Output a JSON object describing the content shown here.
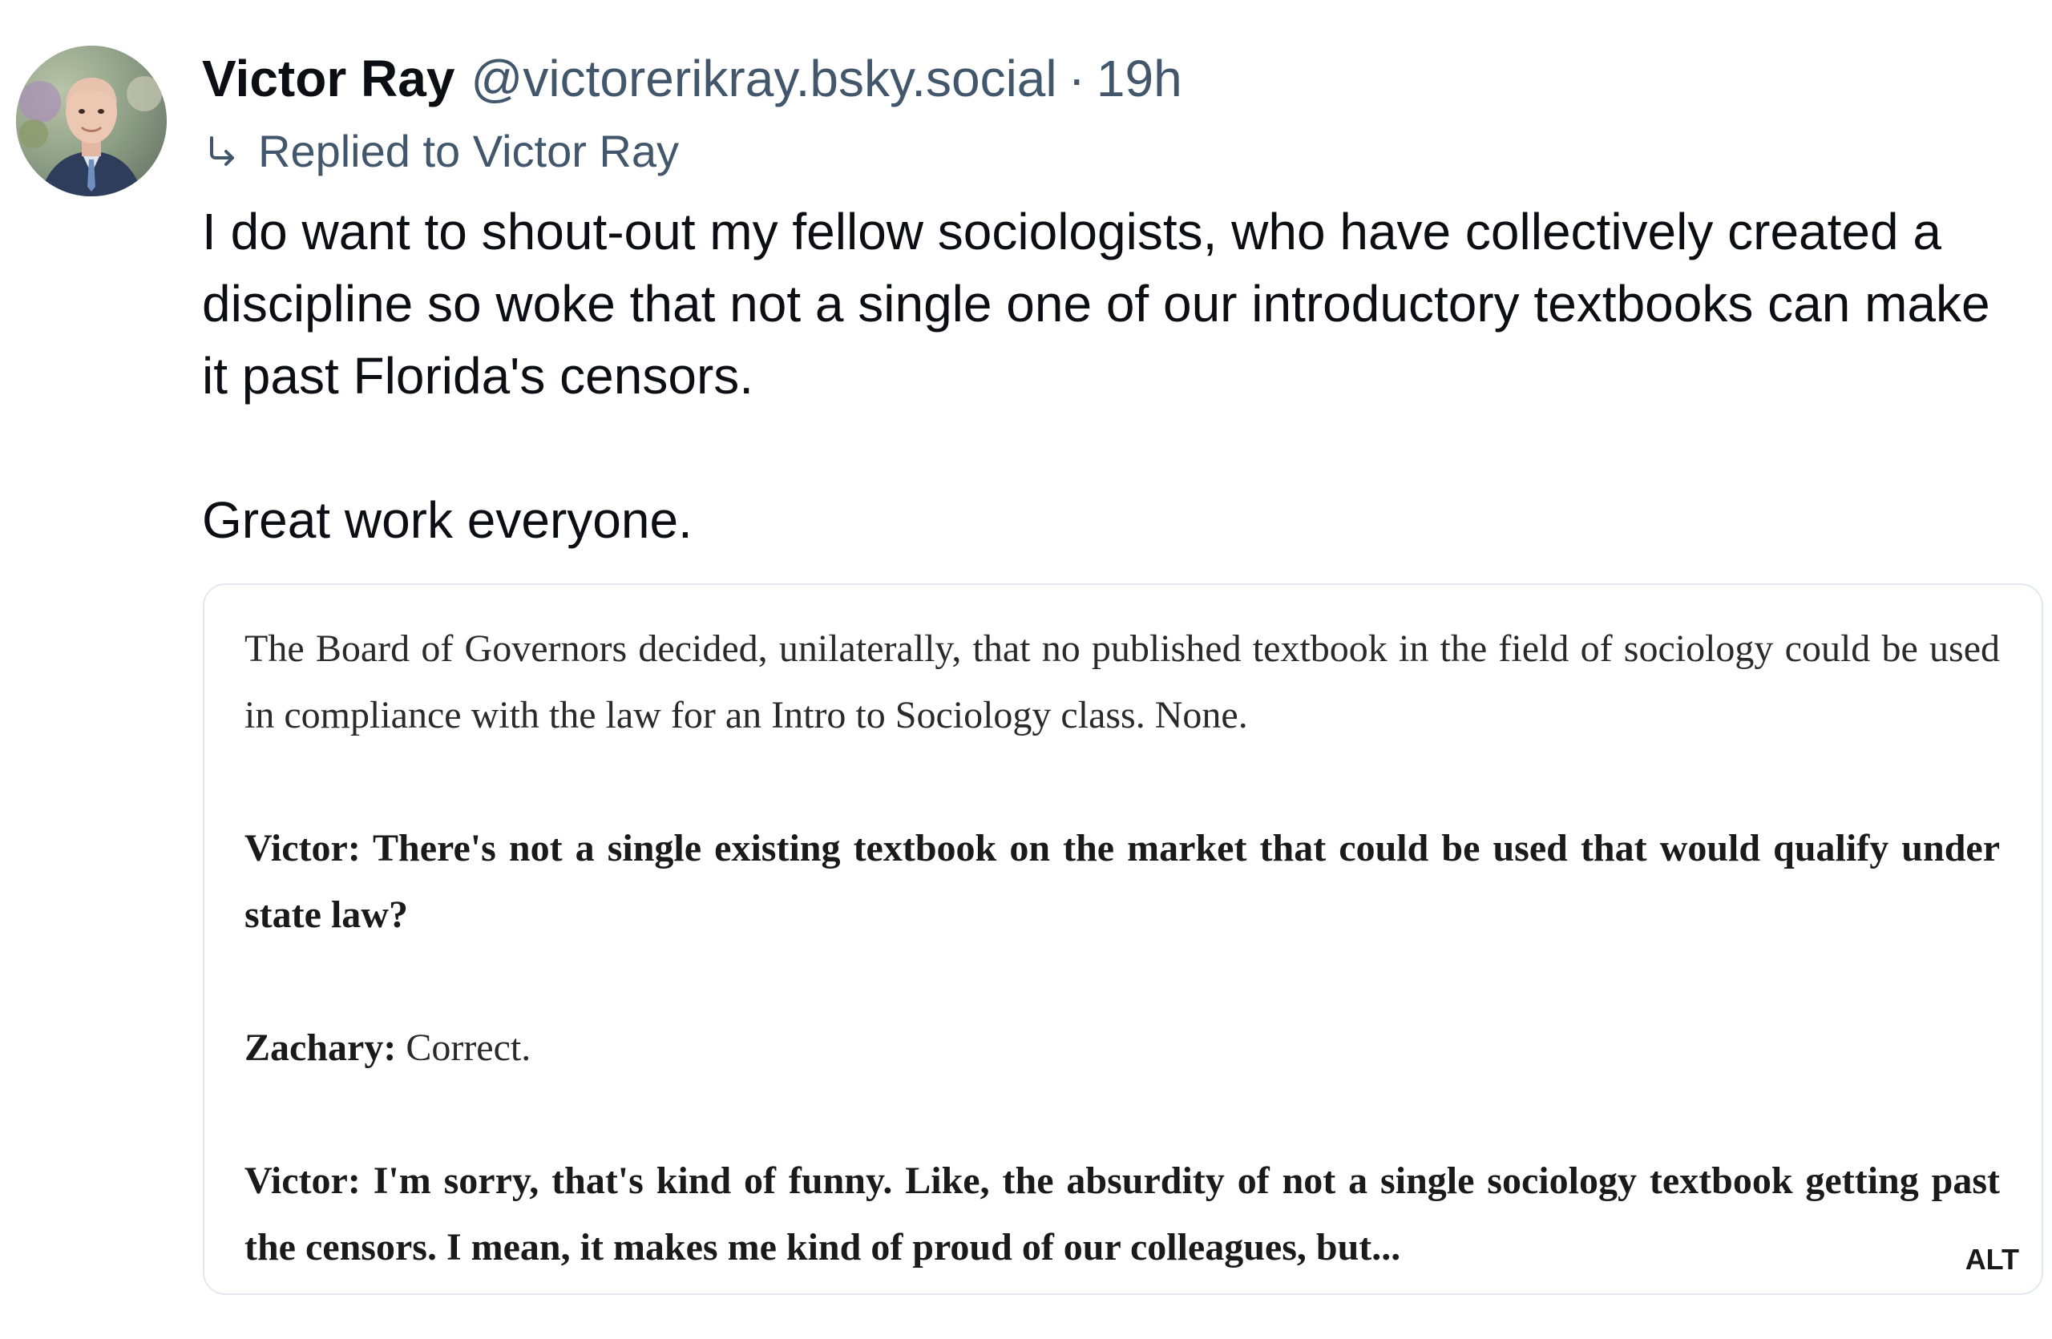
{
  "post": {
    "author": {
      "display_name": "Victor Ray",
      "handle": "@victorerikray.bsky.social",
      "avatar_icon": "user-avatar"
    },
    "separator": "·",
    "timestamp": "19h",
    "reply_context": {
      "icon": "reply-arrow-icon",
      "label": "Replied to Victor Ray"
    },
    "text": {
      "paragraph_1": "I do want to shout-out my fellow sociologists, who have collectively created a discipline so woke that not a single one of our introductory textbooks can make it past Florida's censors.",
      "paragraph_2": "Great work everyone."
    },
    "image_embed": {
      "paragraph_1": "The Board of Governors decided, unilaterally, that no published textbook in the field of sociology could be used in compliance with the law for an Intro to Sociology class. None.",
      "paragraph_2": "Victor: There's not a single existing textbook on the market that could be used that would qualify under state law?",
      "paragraph_3_speaker": "Zachary:",
      "paragraph_3_text": " Correct.",
      "paragraph_4": "Victor: I'm sorry, that's kind of funny. Like, the absurdity of not a single sociology textbook getting past the censors. I mean, it makes me kind of proud of our colleagues, but...",
      "alt_badge": "ALT"
    }
  },
  "colors": {
    "primary_text": "#0b0f14",
    "secondary_text": "#42576c",
    "embed_border": "#e3e8ee",
    "background": "#ffffff"
  }
}
